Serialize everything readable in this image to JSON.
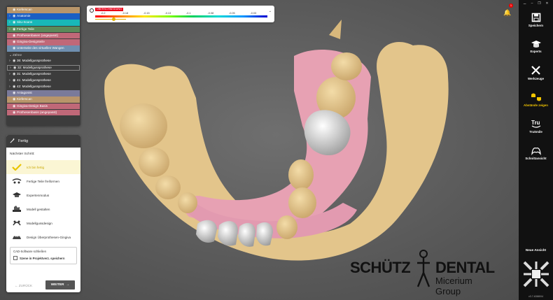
{
  "scene_tree": {
    "rows": [
      {
        "label": "Kieferscan",
        "color": "#b8956a",
        "chev": "",
        "outline": false
      },
      {
        "label": "Anatomie",
        "color": "#1a5fc4",
        "chev": "›",
        "outline": false
      },
      {
        "label": "Situ-Scans",
        "color": "#18b8b8",
        "chev": "›",
        "outline": false
      },
      {
        "label": "Fertige Teile",
        "color": "#5a8a5a",
        "chev": "›",
        "outline": false
      },
      {
        "label": "Prothesenbasen (angepasst)",
        "color": "#c06878",
        "chev": "",
        "outline": false
      },
      {
        "label": "Gingiva-Designteile",
        "color": "#c06878",
        "chev": "",
        "outline": false
      },
      {
        "label": "Unterseite des virtuellen Wangen",
        "color": "#6f8fb0",
        "chev": "",
        "outline": false
      },
      {
        "label": "Zähne",
        "color": "",
        "chev": "⌄",
        "outline": false,
        "sep": true
      },
      {
        "label": "36: Modellgussprothese",
        "color": "#3c3c3c",
        "chev": "›",
        "outline": false
      },
      {
        "label": "32: Modellgussprothese",
        "color": "#3c3c3c",
        "chev": "›",
        "outline": true
      },
      {
        "label": "31: Modellgussprothese",
        "color": "#3c3c3c",
        "chev": "›",
        "outline": false
      },
      {
        "label": "41: Modellgussprothese",
        "color": "#3c3c3c",
        "chev": "›",
        "outline": false
      },
      {
        "label": "42: Modellgussprothese",
        "color": "#3c3c3c",
        "chev": "›",
        "outline": false
      },
      {
        "label": "Antagonist",
        "color": "#7a7a9a",
        "chev": "",
        "outline": false
      },
      {
        "label": "Kieferscan",
        "color": "#b8956a",
        "chev": "",
        "outline": false
      },
      {
        "label": "Gingiva-Design Basis",
        "color": "#c06878",
        "chev": "",
        "outline": false
      },
      {
        "label": "Prothesenbasis (angepasst)",
        "color": "#c06878",
        "chev": "",
        "outline": false
      }
    ]
  },
  "workflow": {
    "title": "Fertig",
    "next_label": "Nächster Schritt:",
    "steps": [
      {
        "label": "Ich bin fertig",
        "icon": "check-icon",
        "active": true
      },
      {
        "label": "Fertige Teile freiformen",
        "icon": "freeform-icon",
        "active": false
      },
      {
        "label": "Expertenmodus",
        "icon": "expert-icon",
        "active": false
      },
      {
        "label": "Modell gestalten",
        "icon": "model-icon",
        "active": false
      },
      {
        "label": "Modellgussdesign",
        "icon": "cast-icon",
        "active": false
      },
      {
        "label": "Design Überprothesen-Gingiva",
        "icon": "gingiva-icon",
        "active": false
      }
    ],
    "cad_title": "CAD-Software schließen",
    "cad_checkbox": "Szene in Projektverz. speichern",
    "back_label": "ZURÜCK",
    "next_button": "WEITER"
  },
  "color_scale": {
    "label": "ÜBERSCHNEIDUNG",
    "ticks": [
      "-0.2",
      "-0.18",
      "-0.15",
      "-0.13",
      "-0.1",
      "-0.08",
      "-0.05",
      "-0.03"
    ],
    "slider_value": 0.22
  },
  "notifications": {
    "count": "1"
  },
  "window_controls": [
    "⚊",
    "–",
    "❐",
    "✕"
  ],
  "toolbar": {
    "tools": [
      {
        "label": "Speichern",
        "icon": "save-icon",
        "active": false
      },
      {
        "label": "Experts",
        "icon": "experts-icon",
        "active": false
      },
      {
        "label": "Werkzeuge",
        "icon": "tools-icon",
        "active": false
      },
      {
        "label": "Abstände zeigen",
        "icon": "distance-icon",
        "active": true
      },
      {
        "label": "TruSmile",
        "icon": "trusmile-icon",
        "active": false
      },
      {
        "label": "Schnittansicht",
        "icon": "section-icon",
        "active": false
      }
    ],
    "new_view": "Neue Ansicht",
    "version": "v3.7-6388/04"
  },
  "logo": {
    "word1": "SCHÜTZ",
    "word2": "DENTAL",
    "group": "Micerium Group"
  },
  "colors": {
    "accent": "#f2c500",
    "toolbar_bg": "#111111",
    "panel_bg": "#3c3c3c"
  }
}
